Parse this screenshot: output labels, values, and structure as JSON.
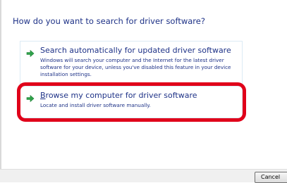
{
  "heading": "How do you want to search for driver software?",
  "options": [
    {
      "title": "Search automatically for updated driver software",
      "description": "Windows will search your computer and the Internet for the latest driver software for your device, unless you've disabled this feature in your device installation settings.",
      "icon": "green-arrow-icon"
    },
    {
      "title_first_letter": "B",
      "title_rest": "rowse my computer for driver software",
      "description": "Locate and install driver software manually.",
      "icon": "green-arrow-icon",
      "highlighted": true
    }
  ],
  "footer": {
    "cancel_label": "Cancel"
  },
  "colors": {
    "link_text": "#1e3287",
    "highlight": "#e0001a",
    "arrow": "#2fa34a"
  }
}
